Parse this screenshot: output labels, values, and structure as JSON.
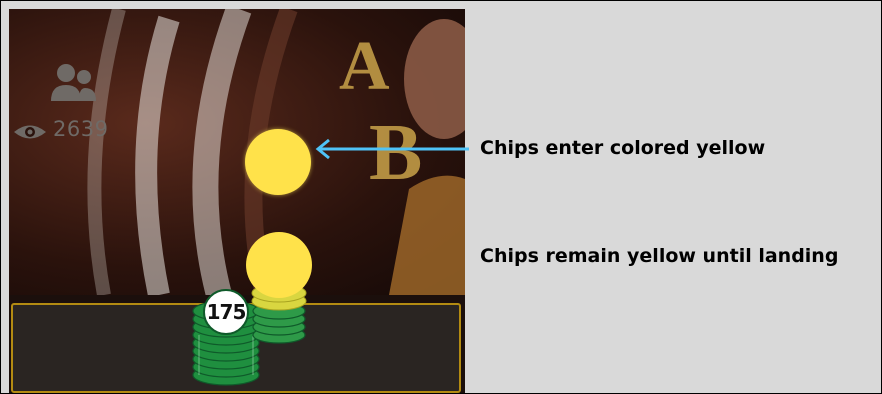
{
  "stats": {
    "viewer_count": "2639",
    "users_icon": "users-icon",
    "viewers_icon": "eye-icon"
  },
  "chips": {
    "stack_value": "175",
    "flying_color": "#ffe24a",
    "stack_color": "#1f8f3f"
  },
  "annotations": {
    "enter": "Chips enter colored yellow",
    "remain": "Chips remain yellow until landing",
    "arrow_color": "#4fc3f7"
  },
  "colors": {
    "panel_border": "#b38b12",
    "panel_bg": "#2a2522"
  }
}
